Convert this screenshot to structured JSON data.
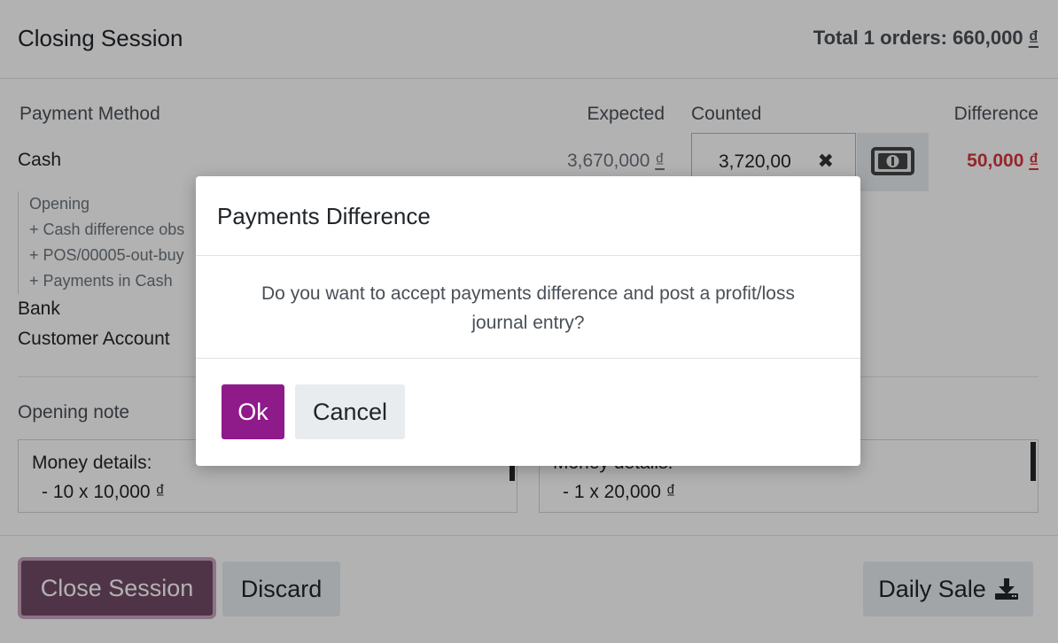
{
  "header": {
    "title": "Closing Session",
    "total_text": "Total 1 orders: 660,000 ",
    "total_currency": "₫"
  },
  "table": {
    "columns": {
      "payment_method": "Payment Method",
      "expected": "Expected",
      "counted": "Counted",
      "difference": "Difference"
    },
    "cash": {
      "label": "Cash",
      "expected_amount": "3,670,000 ",
      "currency": "₫",
      "counted_value": "3,720,00",
      "difference_amount": "50,000 ",
      "details": [
        "Opening",
        "+ Cash difference obs",
        "+ POS/00005-out-buy",
        "+ Payments in Cash"
      ]
    },
    "bank_label": "Bank",
    "customer_account_label": "Customer Account"
  },
  "notes": {
    "opening_label": "Opening note",
    "opening_lines": [
      "Money details:",
      "- 10 x 10,000 ₫"
    ],
    "closing_lines": [
      "Money details:",
      "- 1 x 20,000 ₫"
    ]
  },
  "footer": {
    "close_session": "Close Session",
    "discard": "Discard",
    "daily_sale": "Daily Sale"
  },
  "modal": {
    "title": "Payments Difference",
    "message": "Do you want to accept payments difference and post a profit/loss journal entry?",
    "ok": "Ok",
    "cancel": "Cancel"
  },
  "colors": {
    "primary": "#714b67",
    "modal_ok": "#8f1a8a",
    "difference": "#d9363e"
  },
  "icons": {
    "clear": "times-icon",
    "money": "money-bill-icon",
    "download": "download-icon"
  }
}
